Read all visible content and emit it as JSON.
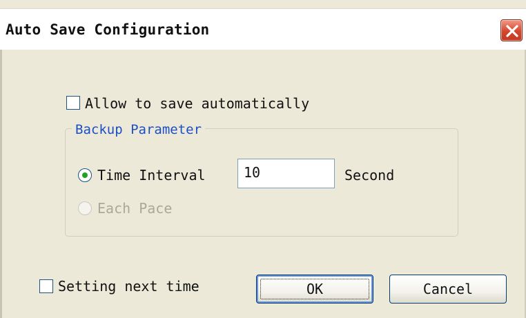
{
  "dialog": {
    "title": "Auto Save Configuration"
  },
  "options": {
    "allow_auto_save_label": "Allow to save automatically",
    "allow_auto_save_checked": false
  },
  "backup": {
    "legend": "Backup Parameter",
    "time_interval_label": "Time Interval",
    "time_interval_selected": true,
    "interval_value": "10",
    "unit_label": "Second",
    "each_pace_label": "Each Pace",
    "each_pace_enabled": false
  },
  "footer": {
    "setting_next_time_label": "Setting next time",
    "setting_next_time_checked": false,
    "ok_label": "OK",
    "cancel_label": "Cancel"
  },
  "icons": {
    "close": "close-icon"
  },
  "colors": {
    "legend_text": "#1c4fc4",
    "radio_dot": "#21a121",
    "close_button": "#d4452c"
  }
}
